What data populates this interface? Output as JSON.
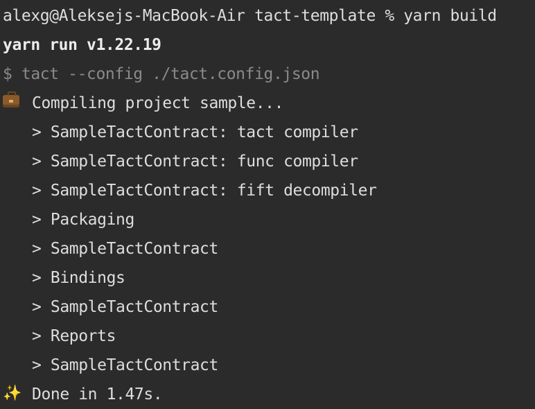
{
  "terminal": {
    "prompt_line": "alexg@Aleksejs-MacBook-Air tact-template % yarn build",
    "yarn_run": "yarn run v1.22.19",
    "command": "$ tact --config ./tact.config.json",
    "compiling_icon": "briefcase-icon",
    "compiling": "Compiling project sample...",
    "steps": [
      "> SampleTactContract: tact compiler",
      "> SampleTactContract: func compiler",
      "> SampleTactContract: fift decompiler",
      "> Packaging",
      "> SampleTactContract",
      "> Bindings",
      "> SampleTactContract",
      "> Reports",
      "> SampleTactContract"
    ],
    "done_icon": "sparkles-icon",
    "done": "Done in 1.47s.",
    "colors": {
      "background": "#2b2b2b",
      "text": "#dedede",
      "dim": "#8a8a8a"
    }
  }
}
